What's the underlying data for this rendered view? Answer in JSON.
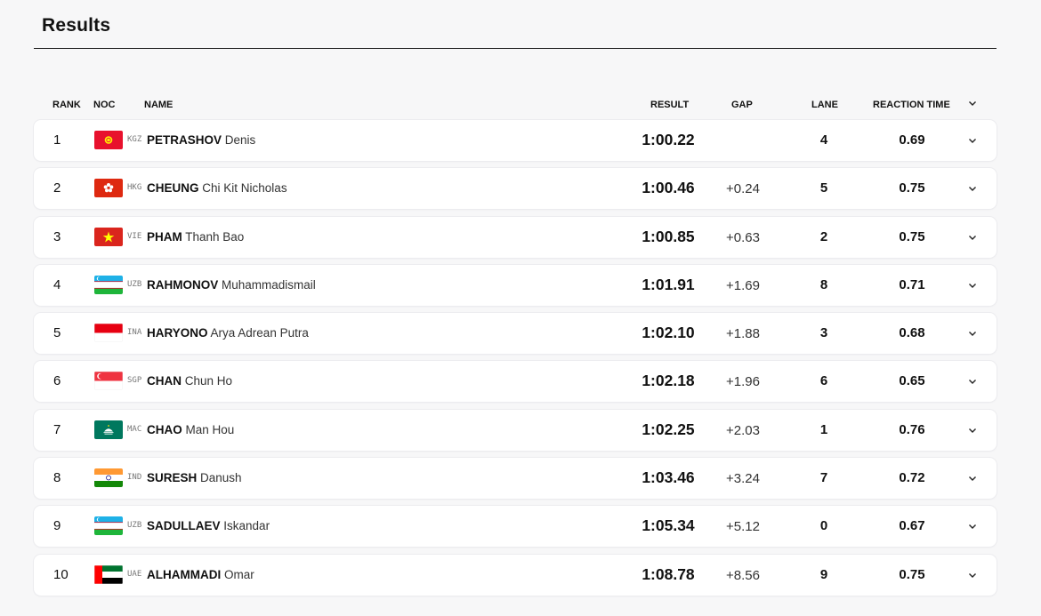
{
  "page": {
    "title": "Results"
  },
  "columns": {
    "rank": "RANK",
    "noc": "NOC",
    "name": "NAME",
    "result": "RESULT",
    "gap": "GAP",
    "lane": "LANE",
    "reaction_time": "REACTION TIME"
  },
  "rows": [
    {
      "rank": "1",
      "noc": "KGZ",
      "surname": "PETRASHOV",
      "given": "Denis",
      "result": "1:00.22",
      "gap": "",
      "lane": "4",
      "rt": "0.69",
      "flag": "kgz-flag-icon"
    },
    {
      "rank": "2",
      "noc": "HKG",
      "surname": "CHEUNG",
      "given": "Chi Kit Nicholas",
      "result": "1:00.46",
      "gap": "+0.24",
      "lane": "5",
      "rt": "0.75",
      "flag": "hkg-flag-icon"
    },
    {
      "rank": "3",
      "noc": "VIE",
      "surname": "PHAM",
      "given": "Thanh Bao",
      "result": "1:00.85",
      "gap": "+0.63",
      "lane": "2",
      "rt": "0.75",
      "flag": "vie-flag-icon"
    },
    {
      "rank": "4",
      "noc": "UZB",
      "surname": "RAHMONOV",
      "given": "Muhammadismail",
      "result": "1:01.91",
      "gap": "+1.69",
      "lane": "8",
      "rt": "0.71",
      "flag": "uzb-flag-icon"
    },
    {
      "rank": "5",
      "noc": "INA",
      "surname": "HARYONO",
      "given": "Arya Adrean Putra",
      "result": "1:02.10",
      "gap": "+1.88",
      "lane": "3",
      "rt": "0.68",
      "flag": "ina-flag-icon"
    },
    {
      "rank": "6",
      "noc": "SGP",
      "surname": "CHAN",
      "given": "Chun Ho",
      "result": "1:02.18",
      "gap": "+1.96",
      "lane": "6",
      "rt": "0.65",
      "flag": "sgp-flag-icon"
    },
    {
      "rank": "7",
      "noc": "MAC",
      "surname": "CHAO",
      "given": "Man Hou",
      "result": "1:02.25",
      "gap": "+2.03",
      "lane": "1",
      "rt": "0.76",
      "flag": "mac-flag-icon"
    },
    {
      "rank": "8",
      "noc": "IND",
      "surname": "SURESH",
      "given": "Danush",
      "result": "1:03.46",
      "gap": "+3.24",
      "lane": "7",
      "rt": "0.72",
      "flag": "ind-flag-icon"
    },
    {
      "rank": "9",
      "noc": "UZB",
      "surname": "SADULLAEV",
      "given": "Iskandar",
      "result": "1:05.34",
      "gap": "+5.12",
      "lane": "0",
      "rt": "0.67",
      "flag": "uzb-flag-icon"
    },
    {
      "rank": "10",
      "noc": "UAE",
      "surname": "ALHAMMADI",
      "given": "Omar",
      "result": "1:08.78",
      "gap": "+8.56",
      "lane": "9",
      "rt": "0.75",
      "flag": "uae-flag-icon"
    }
  ],
  "colors": {
    "page_background": "#f7f7f8",
    "row_background": "#ffffff",
    "text": "#111111"
  }
}
